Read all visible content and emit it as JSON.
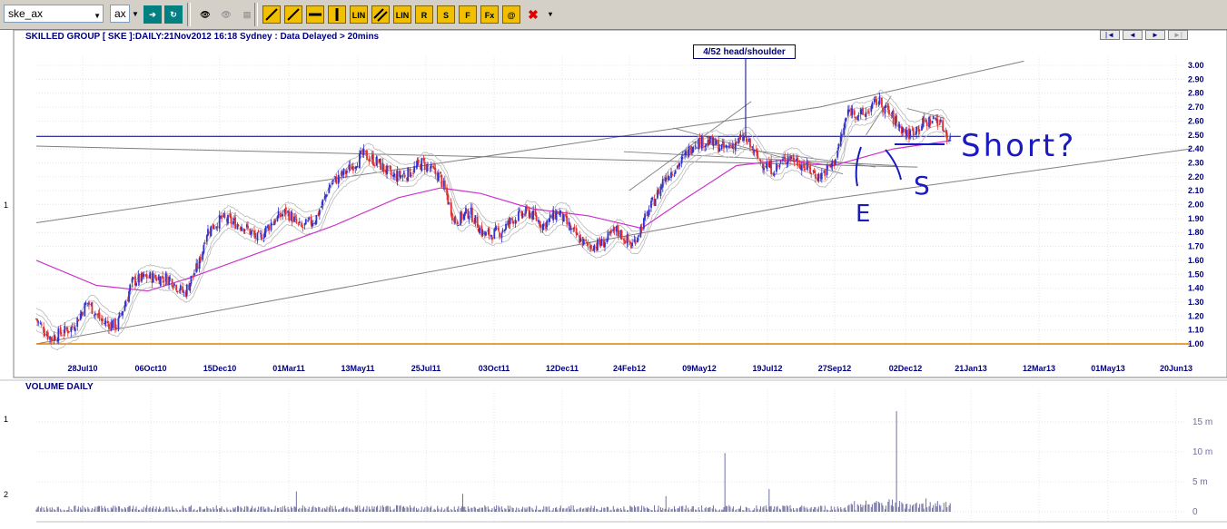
{
  "toolbar": {
    "symbol_combo": "ske_ax",
    "exchange_combo": "ax",
    "tools": [
      "LIN",
      "R",
      "S",
      "F",
      "Fx",
      "@"
    ]
  },
  "chart": {
    "title": "SKILLED GROUP [ SKE ]:DAILY:21Nov2012 16:18 Sydney : Data Delayed > 20mins",
    "annotation": "4/52 head/shoulder",
    "handwriting": {
      "short": "Short?",
      "e": "E",
      "s": "S"
    },
    "side_labels": {
      "price": "1",
      "vol1": "1",
      "vol2": "2"
    },
    "nav": [
      "|◄",
      "◄",
      "►",
      "►|"
    ]
  },
  "volume": {
    "title": "VOLUME DAILY"
  },
  "chart_data": [
    {
      "type": "candlestick",
      "title": "SKILLED GROUP [ SKE ]:DAILY:21Nov2012 16:18 Sydney : Data Delayed > 20mins",
      "x_tick_labels": [
        "28Jul10",
        "06Oct10",
        "15Dec10",
        "01Mar11",
        "13May11",
        "25Jul11",
        "03Oct11",
        "12Dec11",
        "24Feb12",
        "09May12",
        "19Jul12",
        "27Sep12",
        "02Dec12",
        "21Jan13",
        "12Mar13",
        "01May13",
        "20Jun13"
      ],
      "y_tick_labels": [
        "3.00",
        "2.90",
        "2.80",
        "2.70",
        "2.60",
        "2.50",
        "2.40",
        "2.30",
        "2.20",
        "2.10",
        "2.00",
        "1.90",
        "1.80",
        "1.70",
        "1.60",
        "1.50",
        "1.40",
        "1.30",
        "1.20",
        "1.10",
        "1.00"
      ],
      "ylim": [
        1.0,
        3.0
      ],
      "price_path": [
        [
          "2010-07-06",
          1.18
        ],
        [
          "2010-07-20",
          1.04
        ],
        [
          "2010-08-10",
          1.12
        ],
        [
          "2010-08-24",
          1.3
        ],
        [
          "2010-09-07",
          1.16
        ],
        [
          "2010-09-21",
          1.13
        ],
        [
          "2010-10-06",
          1.45
        ],
        [
          "2010-10-20",
          1.48
        ],
        [
          "2010-11-10",
          1.47
        ],
        [
          "2010-11-24",
          1.36
        ],
        [
          "2010-12-08",
          1.58
        ],
        [
          "2010-12-15",
          1.8
        ],
        [
          "2010-12-29",
          1.9
        ],
        [
          "2011-01-19",
          1.85
        ],
        [
          "2011-02-02",
          1.75
        ],
        [
          "2011-02-16",
          1.88
        ],
        [
          "2011-03-01",
          1.95
        ],
        [
          "2011-03-15",
          1.83
        ],
        [
          "2011-03-29",
          1.9
        ],
        [
          "2011-04-12",
          2.15
        ],
        [
          "2011-04-26",
          2.23
        ],
        [
          "2011-05-13",
          2.36
        ],
        [
          "2011-05-27",
          2.3
        ],
        [
          "2011-06-10",
          2.2
        ],
        [
          "2011-06-24",
          2.22
        ],
        [
          "2011-07-08",
          2.3
        ],
        [
          "2011-07-25",
          2.2
        ],
        [
          "2011-08-08",
          1.88
        ],
        [
          "2011-08-22",
          1.95
        ],
        [
          "2011-09-05",
          1.78
        ],
        [
          "2011-09-19",
          1.8
        ],
        [
          "2011-10-03",
          1.9
        ],
        [
          "2011-10-17",
          1.95
        ],
        [
          "2011-10-31",
          1.85
        ],
        [
          "2011-11-14",
          1.95
        ],
        [
          "2011-11-28",
          1.8
        ],
        [
          "2011-12-12",
          1.7
        ],
        [
          "2011-12-26",
          1.72
        ],
        [
          "2012-01-09",
          1.82
        ],
        [
          "2012-01-23",
          1.7
        ],
        [
          "2012-02-06",
          1.92
        ],
        [
          "2012-02-24",
          2.2
        ],
        [
          "2012-03-09",
          2.3
        ],
        [
          "2012-03-23",
          2.45
        ],
        [
          "2012-04-06",
          2.45
        ],
        [
          "2012-04-20",
          2.4
        ],
        [
          "2012-05-09",
          2.48
        ],
        [
          "2012-05-23",
          2.32
        ],
        [
          "2012-06-06",
          2.25
        ],
        [
          "2012-06-20",
          2.35
        ],
        [
          "2012-07-04",
          2.28
        ],
        [
          "2012-07-19",
          2.2
        ],
        [
          "2012-08-02",
          2.3
        ],
        [
          "2012-08-16",
          2.68
        ],
        [
          "2012-08-30",
          2.64
        ],
        [
          "2012-09-13",
          2.75
        ],
        [
          "2012-09-27",
          2.62
        ],
        [
          "2012-10-11",
          2.5
        ],
        [
          "2012-10-25",
          2.58
        ],
        [
          "2012-11-08",
          2.62
        ],
        [
          "2012-11-21",
          2.46
        ]
      ],
      "moving_average_path": [
        [
          "2010-07-06",
          1.6
        ],
        [
          "2010-09-01",
          1.42
        ],
        [
          "2010-10-20",
          1.38
        ],
        [
          "2010-12-01",
          1.48
        ],
        [
          "2011-02-01",
          1.65
        ],
        [
          "2011-04-15",
          1.85
        ],
        [
          "2011-06-15",
          2.05
        ],
        [
          "2011-07-25",
          2.12
        ],
        [
          "2011-09-01",
          2.08
        ],
        [
          "2011-10-20",
          1.97
        ],
        [
          "2011-12-12",
          1.92
        ],
        [
          "2012-02-01",
          1.83
        ],
        [
          "2012-03-15",
          2.05
        ],
        [
          "2012-05-01",
          2.28
        ],
        [
          "2012-06-15",
          2.32
        ],
        [
          "2012-08-01",
          2.28
        ],
        [
          "2012-09-27",
          2.4
        ],
        [
          "2012-11-21",
          2.46
        ]
      ],
      "trendlines": {
        "channel_upper": [
          [
            "2010-07-06",
            1.87
          ],
          [
            "2012-07-19",
            2.7
          ],
          [
            "2013-01-29",
            3.03
          ]
        ],
        "channel_lower": [
          [
            "2010-07-06",
            1.0
          ],
          [
            "2012-07-19",
            2.03
          ],
          [
            "2013-07-06",
            2.4
          ]
        ],
        "neckline": [
          [
            "2010-07-06",
            2.49
          ],
          [
            "2012-11-30",
            2.49
          ]
        ],
        "support": [
          [
            "2010-07-06",
            2.42
          ],
          [
            "2012-10-20",
            2.27
          ]
        ],
        "baseline": [
          [
            "2010-07-06",
            1.0
          ],
          [
            "2013-07-06",
            1.0
          ]
        ]
      },
      "volume_ticks": [
        "15 m",
        "10 m",
        "5 m",
        "0"
      ],
      "volume_ylim": [
        0,
        19
      ],
      "volume_spikes": [
        [
          "2012-04-20",
          9.8
        ],
        [
          "2012-09-30",
          16.8
        ],
        [
          "2011-03-10",
          3.4
        ],
        [
          "2011-08-15",
          3.0
        ],
        [
          "2012-02-24",
          2.6
        ],
        [
          "2012-06-01",
          3.8
        ]
      ]
    }
  ]
}
